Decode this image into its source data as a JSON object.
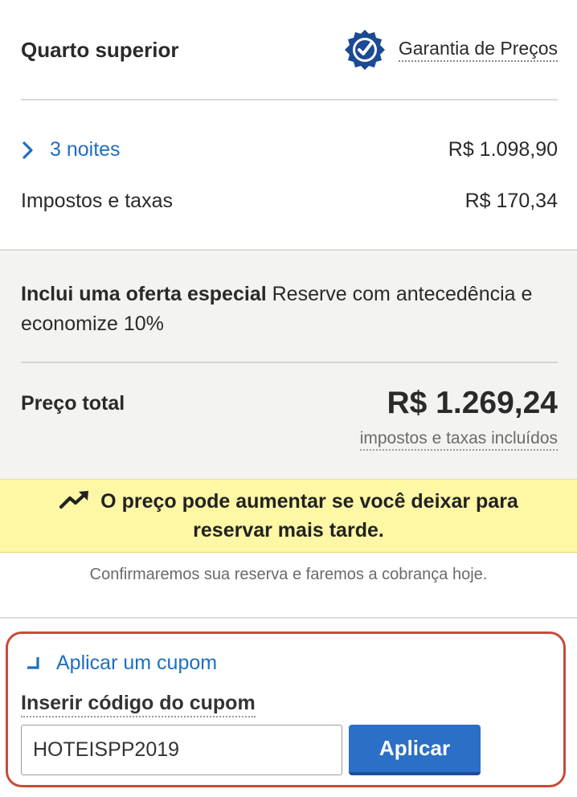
{
  "room": {
    "title": "Quarto superior"
  },
  "guarantee": {
    "label": "Garantia de Preços",
    "icon": "badge-check-icon"
  },
  "pricing": {
    "nights_label": "3 noites",
    "nights_amount": "R$ 1.098,90",
    "taxes_label": "Impostos e taxas",
    "taxes_amount": "R$ 170,34"
  },
  "offer": {
    "bold": "Inclui uma oferta especial",
    "text": " Reserve com antecedência e economize 10%"
  },
  "total": {
    "label": "Preço total",
    "amount": "R$ 1.269,24",
    "note": "impostos e taxas incluídos"
  },
  "warning": {
    "text": "O preço pode aumentar se você deixar para reservar mais tarde.",
    "icon": "trending-up-icon"
  },
  "confirm_text": "Confirmaremos sua reserva e faremos a cobrança hoje.",
  "coupon": {
    "toggle_label": "Aplicar um cupom",
    "field_label": "Inserir código do cupom",
    "value": "HOTEISPP2019",
    "button_label": "Aplicar"
  },
  "colors": {
    "link": "#1e6fbf",
    "button": "#2b6fc6",
    "warning_bg": "#fdf7a6",
    "highlight_border": "#c84b3a",
    "panel_bg": "#f3f3f1"
  }
}
